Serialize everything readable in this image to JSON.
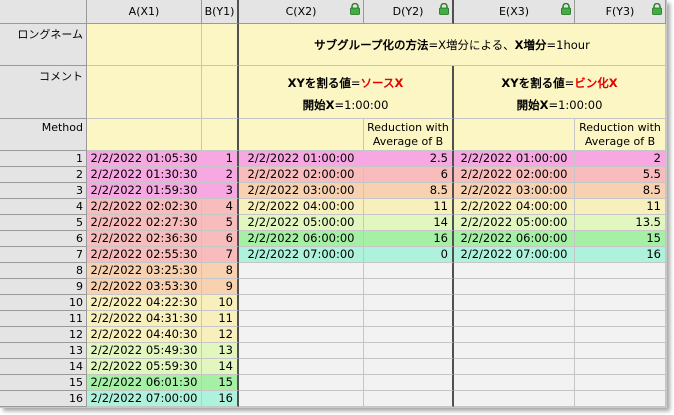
{
  "columns": [
    {
      "label": "A(X1)",
      "lock": false
    },
    {
      "label": "B(Y1)",
      "lock": false
    },
    {
      "label": "C(X2)",
      "lock": true
    },
    {
      "label": "D(Y2)",
      "lock": true
    },
    {
      "label": "E(X3)",
      "lock": true
    },
    {
      "label": "F(Y3)",
      "lock": true
    }
  ],
  "row_labels": {
    "long_name": "ロングネーム",
    "comment": "コメント",
    "method": "Method"
  },
  "long_name": {
    "prefix": "サブグループ化の方法",
    "middle": "=X増分による、",
    "bold2": "X増分",
    "suffix": "=1hour"
  },
  "comment_c": {
    "prefix": "XYを割る値",
    "eq": "=",
    "value": "ソースX",
    "start_label": "開始X",
    "start_value": "=1:00:00"
  },
  "comment_e": {
    "prefix": "XYを割る値",
    "eq": "=",
    "value": "ビン化X",
    "start_label": "開始X",
    "start_value": "=1:00:00"
  },
  "method_d": {
    "line1": "Reduction with",
    "line2": "Average of B"
  },
  "method_f": {
    "line1": "Reduction with",
    "line2": "Average of B"
  },
  "colors": {
    "pink": "#f7a8e2",
    "salmon": "#f8bcbc",
    "peach": "#f8d2b0",
    "lightyellow": "#f8f0bc",
    "yellowgreen": "#e2f6c0",
    "green": "#a6f0a6",
    "teal": "#aef2de",
    "meta": "#fbf6c4",
    "header": "#e4e4e4",
    "lock": "#2e9e2e"
  },
  "rows": [
    {
      "n": "1",
      "a": "2/2/2022 01:05:30",
      "b": "1",
      "c": "2/2/2022 01:00:00",
      "d": "2.5",
      "e": "2/2/2022 01:00:00",
      "f": "2",
      "ab": "pink",
      "cd": "pink"
    },
    {
      "n": "2",
      "a": "2/2/2022 01:30:30",
      "b": "2",
      "c": "2/2/2022 02:00:00",
      "d": "6",
      "e": "2/2/2022 02:00:00",
      "f": "5.5",
      "ab": "pink",
      "cd": "salmon"
    },
    {
      "n": "3",
      "a": "2/2/2022 01:59:30",
      "b": "3",
      "c": "2/2/2022 03:00:00",
      "d": "8.5",
      "e": "2/2/2022 03:00:00",
      "f": "8.5",
      "ab": "pink",
      "cd": "peach"
    },
    {
      "n": "4",
      "a": "2/2/2022 02:02:30",
      "b": "4",
      "c": "2/2/2022 04:00:00",
      "d": "11",
      "e": "2/2/2022 04:00:00",
      "f": "11",
      "ab": "salmon",
      "cd": "lightyellow"
    },
    {
      "n": "5",
      "a": "2/2/2022 02:27:30",
      "b": "5",
      "c": "2/2/2022 05:00:00",
      "d": "14",
      "e": "2/2/2022 05:00:00",
      "f": "13.5",
      "ab": "salmon",
      "cd": "yellowgreen"
    },
    {
      "n": "6",
      "a": "2/2/2022 02:36:30",
      "b": "6",
      "c": "2/2/2022 06:00:00",
      "d": "16",
      "e": "2/2/2022 06:00:00",
      "f": "15",
      "ab": "salmon",
      "cd": "green"
    },
    {
      "n": "7",
      "a": "2/2/2022 02:55:30",
      "b": "7",
      "c": "2/2/2022 07:00:00",
      "d": "0",
      "e": "2/2/2022 07:00:00",
      "f": "16",
      "ab": "salmon",
      "cd": "teal"
    },
    {
      "n": "8",
      "a": "2/2/2022 03:25:30",
      "b": "8",
      "ab": "peach"
    },
    {
      "n": "9",
      "a": "2/2/2022 03:53:30",
      "b": "9",
      "ab": "peach"
    },
    {
      "n": "10",
      "a": "2/2/2022 04:22:30",
      "b": "10",
      "ab": "lightyellow"
    },
    {
      "n": "11",
      "a": "2/2/2022 04:31:30",
      "b": "11",
      "ab": "lightyellow"
    },
    {
      "n": "12",
      "a": "2/2/2022 04:40:30",
      "b": "12",
      "ab": "lightyellow"
    },
    {
      "n": "13",
      "a": "2/2/2022 05:49:30",
      "b": "13",
      "ab": "yellowgreen"
    },
    {
      "n": "14",
      "a": "2/2/2022 05:59:30",
      "b": "14",
      "ab": "yellowgreen"
    },
    {
      "n": "15",
      "a": "2/2/2022 06:01:30",
      "b": "15",
      "ab": "green"
    },
    {
      "n": "16",
      "a": "2/2/2022 07:00:00",
      "b": "16",
      "ab": "teal"
    }
  ]
}
